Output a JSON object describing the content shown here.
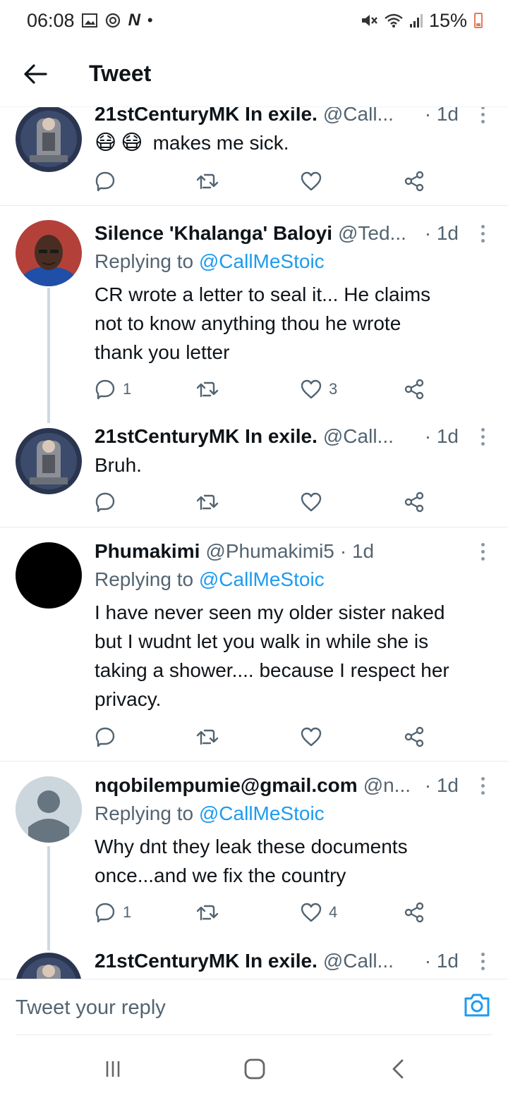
{
  "status_bar": {
    "time": "06:08",
    "notif_n": "N",
    "notif_dot": "•",
    "battery": "15%",
    "left_icons": [
      "gallery-icon",
      "sync-icon",
      "n-app-icon"
    ],
    "right_icons": [
      "mute-icon",
      "wifi-icon",
      "signal-icon",
      "battery-icon"
    ]
  },
  "header": {
    "title": "Tweet",
    "back_icon": "arrow-left-icon"
  },
  "colors": {
    "link": "#1d9bf0",
    "secondary_text": "#536471",
    "primary_text": "#0f1419",
    "divider": "#e6ecf0"
  },
  "tweets": [
    {
      "name": "21stCenturyMK In exile.",
      "handle": "@Call...",
      "time": "· 1d",
      "replying_to": "",
      "emoji": [
        "😷",
        "😷"
      ],
      "text": "makes me sick.",
      "reply_count": "",
      "like_count": ""
    },
    {
      "name": "Silence 'Khalanga' Baloyi",
      "handle": "@Ted...",
      "time": "· 1d",
      "replying_prefix": "Replying to",
      "replying_to": "@CallMeStoic",
      "lines": [
        "CR wrote a letter to seal it... He claims",
        "not to know anything thou he wrote",
        "thank you letter"
      ],
      "reply_count": "1",
      "like_count": "3"
    },
    {
      "name": "21stCenturyMK In exile.",
      "handle": "@Call...",
      "time": "· 1d",
      "text": "Bruh.",
      "reply_count": "",
      "like_count": ""
    },
    {
      "name": "Phumakimi",
      "handle": "@Phumakimi5",
      "time": "· 1d",
      "replying_prefix": "Replying to",
      "replying_to": "@CallMeStoic",
      "lines": [
        "I have never seen my older sister naked",
        "but I wudnt let you walk in while she is",
        "taking a shower.... because I respect her",
        "privacy."
      ],
      "reply_count": "",
      "like_count": ""
    },
    {
      "name": "nqobilempumie@gmail.com",
      "handle": "@n...",
      "time": "· 1d",
      "replying_prefix": "Replying to",
      "replying_to": "@CallMeStoic",
      "lines": [
        "Why dnt they leak these documents",
        "once...and we fix the country"
      ],
      "reply_count": "1",
      "like_count": "4"
    },
    {
      "name": "21stCenturyMK In exile.",
      "handle": "@Call...",
      "time": "· 1d"
    }
  ],
  "reply_bar": {
    "placeholder": "Tweet your reply",
    "camera_icon": "camera-icon"
  },
  "nav_bar": {
    "icons": [
      "recent-apps-icon",
      "home-icon",
      "back-icon"
    ]
  }
}
